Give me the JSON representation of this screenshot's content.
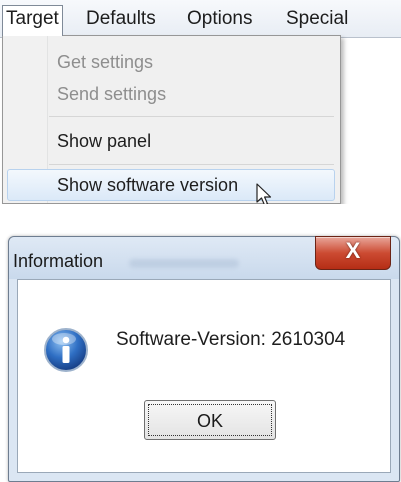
{
  "menubar": {
    "items": [
      {
        "label": "Target"
      },
      {
        "label": "Defaults"
      },
      {
        "label": "Options"
      },
      {
        "label": "Special"
      }
    ]
  },
  "dropdown": {
    "items": [
      {
        "label": "Get settings",
        "enabled": false
      },
      {
        "label": "Send settings",
        "enabled": false
      },
      {
        "label": "Show panel",
        "enabled": true
      },
      {
        "label": "Show software version",
        "enabled": true,
        "highlighted": true
      }
    ]
  },
  "dialog": {
    "title": "Information",
    "close_label": "X",
    "message": "Software-Version: 2610304",
    "ok_label": "OK",
    "icon": "information-icon"
  },
  "colors": {
    "close_button": "#cc4b32",
    "info_icon": "#2f6fc4",
    "highlight": "#dbe9f8"
  }
}
